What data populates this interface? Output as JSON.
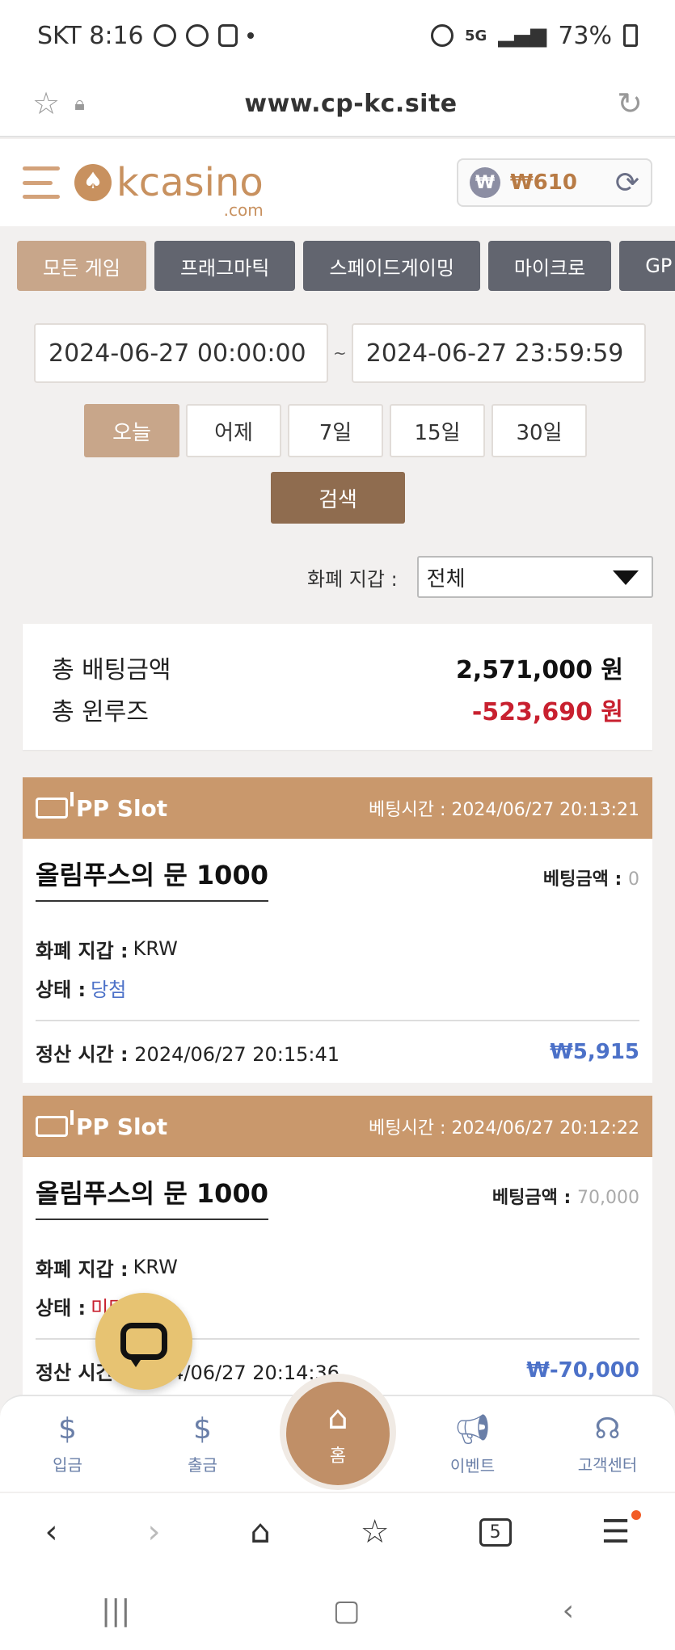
{
  "status_bar": {
    "carrier_time": "SKT 8:16",
    "network": "5G",
    "battery": "73%"
  },
  "browser": {
    "url": "www.cp-kc.site"
  },
  "header": {
    "logo_text": "kcasino",
    "logo_sub": ".com",
    "wallet_balance": "₩610",
    "wallet_coin": "₩"
  },
  "tabs": [
    {
      "label": "모든 게임",
      "active": true
    },
    {
      "label": "프래그마틱"
    },
    {
      "label": "스페이드게이밍"
    },
    {
      "label": "마이크로"
    },
    {
      "label": "GP"
    }
  ],
  "filters": {
    "date_from": "2024-06-27 00:00:00",
    "separator": "~",
    "date_to": "2024-06-27 23:59:59",
    "quick": [
      "오늘",
      "어제",
      "7일",
      "15일",
      "30일"
    ],
    "search_label": "검색",
    "wallet_label": "화폐 지갑 :",
    "wallet_value": "전체"
  },
  "summary": {
    "total_bet_label": "총 배팅금액",
    "total_bet_value": "2,571,000 원",
    "total_winloss_label": "총 윈루즈",
    "total_winloss_value": "-523,690 원"
  },
  "bets": [
    {
      "provider": "PP Slot",
      "bet_time": "베팅시간 : 2024/06/27 20:13:21",
      "game": "올림푸스의 문 1000",
      "bet_amount_label": "베팅금액 :",
      "bet_amount": "0",
      "currency_label": "화폐 지갑 :",
      "currency": "KRW",
      "status_label": "상태 :",
      "status": "당첨",
      "settle_label": "정산 시간 :",
      "settle_time": "2024/06/27 20:15:41",
      "payout": "₩5,915"
    },
    {
      "provider": "PP Slot",
      "bet_time": "베팅시간 : 2024/06/27 20:12:22",
      "game": "올림푸스의 문 1000",
      "bet_amount_label": "베팅금액 :",
      "bet_amount": "70,000",
      "currency_label": "화폐 지갑 :",
      "currency": "KRW",
      "status_label": "상태 :",
      "status": "미당첨",
      "settle_label": "정산 시간 :",
      "settle_time": "2024/06/27 20:14:36",
      "payout": "₩-70,000"
    }
  ],
  "bottom_nav": {
    "deposit": "입금",
    "withdraw": "출금",
    "home": "홈",
    "event": "이벤트",
    "support": "고객센터"
  },
  "browser_tabs_count": "5",
  "colors": {
    "accent": "#c9986c",
    "tab_active": "#c8a68a",
    "tab_inactive": "#62656f",
    "negative": "#c8202f",
    "positive": "#4c71c8"
  }
}
